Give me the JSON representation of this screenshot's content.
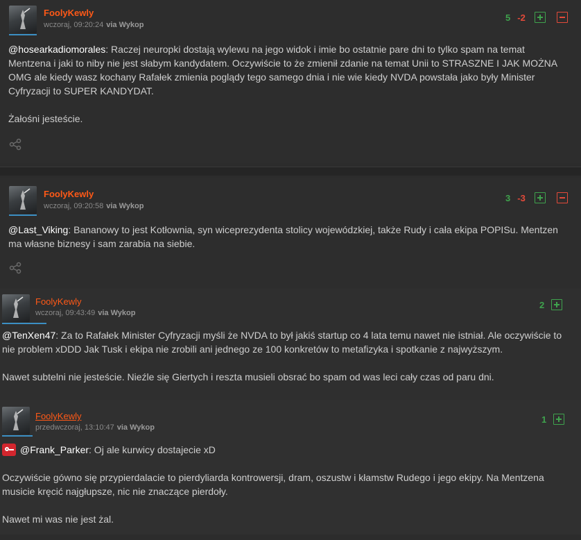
{
  "comments": [
    {
      "author": "FoolyKewly",
      "time": "wczoraj, 09:20:24",
      "via": "via Wykop",
      "votes_plus": "5",
      "votes_minus": "-2",
      "mention": "@hosearkadiomorales",
      "text1": ": Raczej neuropki dostają wylewu na jego widok i imie bo ostatnie pare dni to tylko spam na temat Mentzena i jaki to niby nie jest słabym kandydatem. Oczywiście to że zmienił zdanie na temat Unii to STRASZNE I JAK MOŻNA OMG ale kiedy wasz kochany Rafałek zmienia poglądy tego samego dnia i nie wie kiedy NVDA powstała jako były Minister Cyfryzacji to SUPER KANDYDAT.",
      "text2": "Żałośni jesteście."
    },
    {
      "author": "FoolyKewly",
      "time": "wczoraj, 09:20:58",
      "via": "via Wykop",
      "votes_plus": "3",
      "votes_minus": "-3",
      "mention": "@Last_Viking",
      "text1": ": Bananowy to jest Kotłownia, syn wiceprezydenta stolicy wojewódzkiej, także Rudy i cała ekipa POPISu. Mentzen ma własne biznesy i sam zarabia na siebie."
    },
    {
      "author": "FoolyKewly",
      "time": "wczoraj, 09:43:49",
      "via": "via Wykop",
      "votes_plus": "2",
      "mention": "@TenXen47",
      "text1": ": Za to Rafałek Minister Cyfryzacji myśli że NVDA to był jakiś startup co 4 lata temu nawet nie istniał. Ale oczywiście to nie problem xDDD Jak Tusk i ekipa nie zrobili ani jednego ze 100 konkretów to metafizyka i spotkanie z najwyższym.",
      "text2": "Nawet subtelni nie jesteście. Nieźle się Giertych i reszta musieli obsrać bo spam od was leci cały czas od paru dni."
    },
    {
      "author": "FoolyKewly",
      "time": "przedwczoraj, 13:10:47",
      "via": "via Wykop",
      "votes_plus": "1",
      "mention": "@Frank_Parker",
      "text1": ": Oj ale kurwicy dostajecie xD",
      "text2": "Oczywiście gówno się przypierdalacie to pierdyliarda kontrowersji, dram, oszustw i kłamstw Rudego i jego ekipy. Na Mentzena musicie kręcić najgłupsze, nic nie znaczące pierdoły.",
      "text3": "Nawet mi was nie jest żal."
    }
  ],
  "colors": {
    "author": "#ff5917",
    "plus": "#3fa34d",
    "minus": "#e44a3a",
    "background": "#2c2c2c"
  },
  "icons": [
    "share-icon",
    "plus-icon",
    "minus-icon",
    "key-badge-icon",
    "avatar"
  ]
}
